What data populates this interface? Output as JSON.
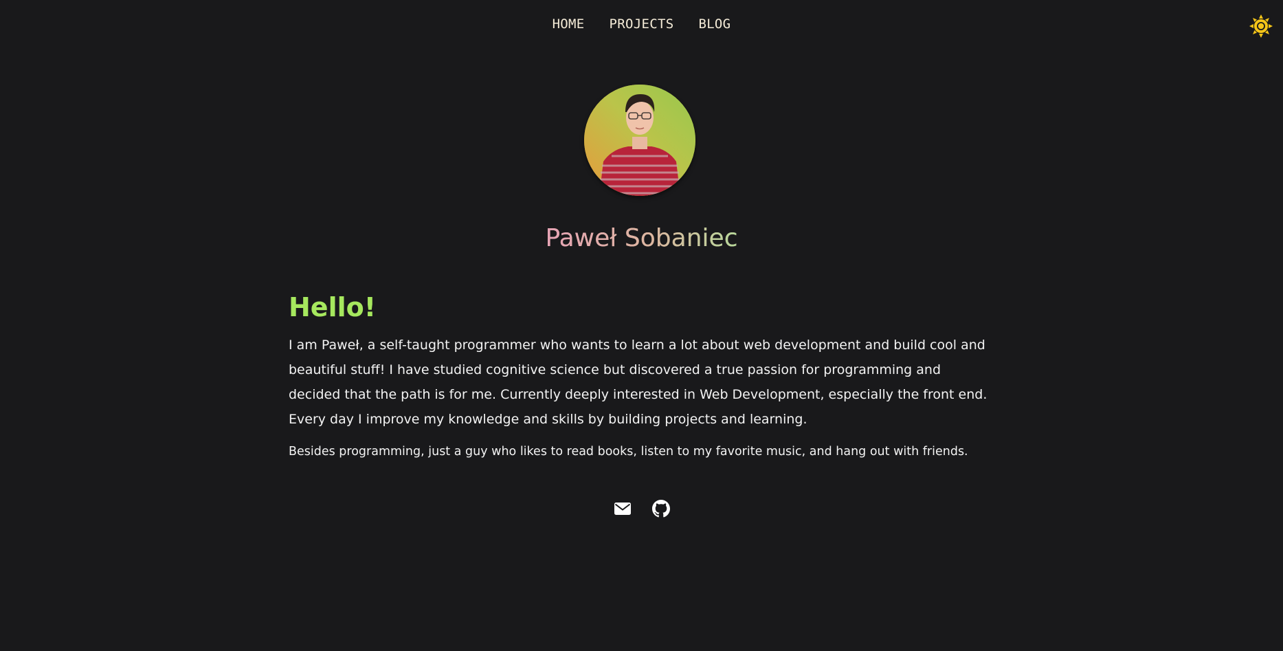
{
  "nav": {
    "items": [
      {
        "label": "HOME"
      },
      {
        "label": "PROJECTS"
      },
      {
        "label": "BLOG"
      }
    ]
  },
  "theme_toggle": {
    "icon": "sun-icon",
    "color": "#f5c518"
  },
  "profile": {
    "name": "Paweł Sobaniec"
  },
  "about": {
    "heading": "Hello!",
    "paragraph_1": "I am Paweł, a self-taught programmer who wants to learn a lot about web development and build cool and beautiful stuff! I have studied cognitive science but discovered a true passion for programming and decided that the path is for me. Currently deeply interested in Web Development, especially the front end. Every day I improve my knowledge and skills by building projects and learning.",
    "paragraph_2": "Besides programming, just a guy who likes to read books, listen to my favorite music, and hang out with friends."
  },
  "socials": [
    {
      "icon": "envelope-icon"
    },
    {
      "icon": "github-icon"
    }
  ],
  "colors": {
    "background": "#19191b",
    "heading_accent": "#a6e85e",
    "nav_text": "#f5ecd8",
    "body_text": "#f3f3f3"
  }
}
